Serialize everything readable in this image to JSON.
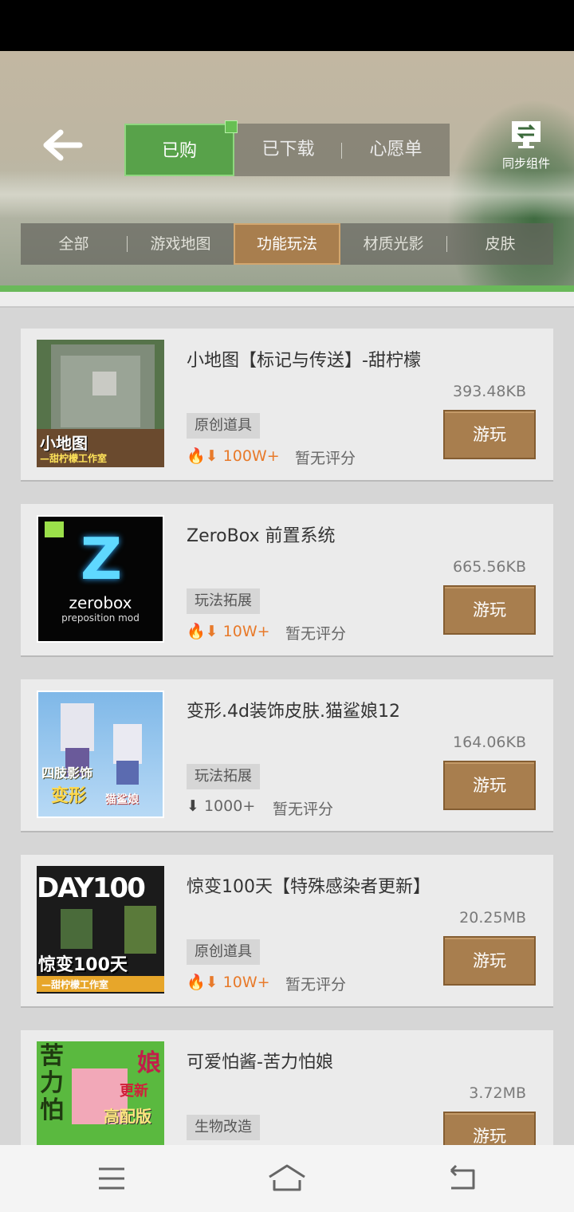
{
  "header": {
    "tabs": [
      {
        "label": "已购",
        "active": true
      },
      {
        "label": "已下载",
        "active": false
      },
      {
        "label": "心愿单",
        "active": false
      }
    ],
    "sync_label": "同步组件"
  },
  "subtabs": [
    {
      "label": "全部",
      "active": false
    },
    {
      "label": "游戏地图",
      "active": false
    },
    {
      "label": "功能玩法",
      "active": true
    },
    {
      "label": "材质光影",
      "active": false
    },
    {
      "label": "皮肤",
      "active": false
    }
  ],
  "items": [
    {
      "title": "小地图【标记与传送】-甜柠檬",
      "size": "393.48KB",
      "tag": "原创道具",
      "downloads": "100W+",
      "hot": true,
      "rating": "暂无评分",
      "play_label": "游玩",
      "thumb_text": [
        "小地图",
        "—甜柠檬工作室"
      ]
    },
    {
      "title": "ZeroBox 前置系统",
      "size": "665.56KB",
      "tag": "玩法拓展",
      "downloads": "10W+",
      "hot": true,
      "rating": "暂无评分",
      "play_label": "游玩",
      "thumb_text": [
        "zerobox",
        "preposition mod"
      ]
    },
    {
      "title": "变形.4d装饰皮肤.猫鲨娘12",
      "size": "164.06KB",
      "tag": "玩法拓展",
      "downloads": "1000+",
      "hot": false,
      "rating": "暂无评分",
      "play_label": "游玩",
      "thumb_text": [
        "四肢影饰",
        "变形",
        "猫鲨娘"
      ]
    },
    {
      "title": "惊变100天【特殊感染者更新】",
      "size": "20.25MB",
      "tag": "原创道具",
      "downloads": "10W+",
      "hot": true,
      "rating": "暂无评分",
      "play_label": "游玩",
      "thumb_text": [
        "DAY100",
        "惊变100天",
        "—甜柠檬工作室"
      ]
    },
    {
      "title": "可爱怕酱-苦力怕娘",
      "size": "3.72MB",
      "tag": "生物改造",
      "downloads": "",
      "hot": false,
      "rating": "",
      "play_label": "游玩",
      "thumb_text": [
        "苦力怕",
        "娘",
        "更新",
        "高配版"
      ]
    }
  ],
  "colors": {
    "accent_green": "#58a24a",
    "brown": "#a87e4e",
    "hot_orange": "#e87a2a"
  },
  "icons": {
    "back": "arrow-left-icon",
    "sync": "sync-monitor-icon",
    "fire": "fire-icon",
    "download": "download-arrow-icon",
    "nav": [
      "menu-icon",
      "home-icon",
      "back-nav-icon"
    ]
  }
}
